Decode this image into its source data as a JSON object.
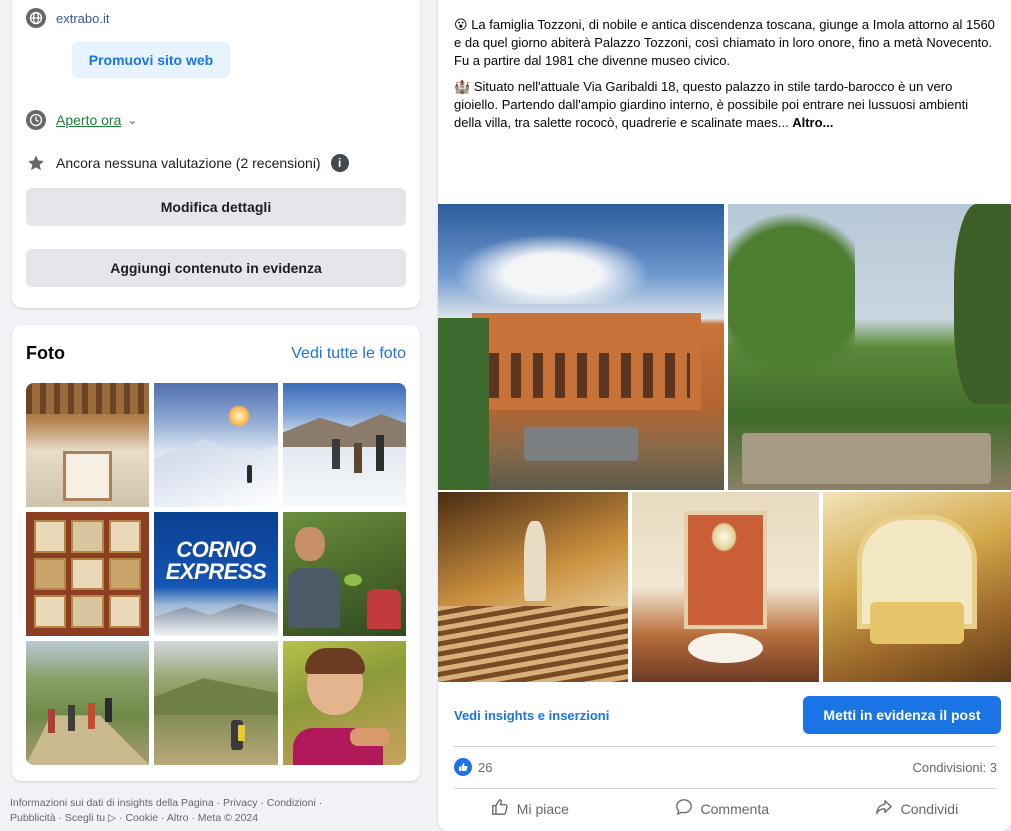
{
  "info": {
    "website": "extrabo.it",
    "promote_label": "Promuovi sito web",
    "hours_status": "Aperto ora",
    "hours_chevron": "⌄",
    "rating_text": "Ancora nessuna valutazione (2 recensioni)",
    "info_glyph": "i",
    "edit_details_label": "Modifica dettagli",
    "add_featured_label": "Aggiungi contenuto in evidenza"
  },
  "photos": {
    "title": "Foto",
    "see_all_label": "Vedi tutte le foto",
    "corno_line1": "CORNO",
    "corno_line2": "EXPRESS"
  },
  "footer": {
    "line1": "Informazioni sui dati di insights della Pagina · Privacy · Condizioni ·",
    "line2": "Pubblicità · Scegli tu ▷ · Cookie · Altro · Meta © 2024"
  },
  "post": {
    "para1": "La famiglia Tozzoni, di nobile e antica discendenza toscana, giunge a Imola attorno al 1560 e da quel giorno abiterà Palazzo Tozzoni, così chiamato in loro onore, fino a metà Novecento. Fu a partire dal 1981 che divenne museo civico.",
    "para2": "Situato nell'attuale Via Garibaldi 18, questo palazzo in stile tardo-barocco è un vero gioiello. Partendo dall'ampio giardino interno, è possibile poi entrare nei lussuosi ambienti della villa, tra salette rococò, quadrerie e scalinate maes...",
    "more_label": "Altro...",
    "emoji1": "😮",
    "emoji2": "🏰",
    "insights_label": "Vedi insights e inserzioni",
    "boost_label": "Metti in evidenza il post",
    "like_count": "26",
    "shares_label": "Condivisioni: 3",
    "like_label": "Mi piace",
    "comment_label": "Commenta",
    "share_label": "Condividi"
  },
  "colors": {
    "accent": "#1b74e4",
    "green_link": "#1a7f37",
    "button_gray": "#e4e6eb",
    "page_bg": "#f0f2f5"
  }
}
